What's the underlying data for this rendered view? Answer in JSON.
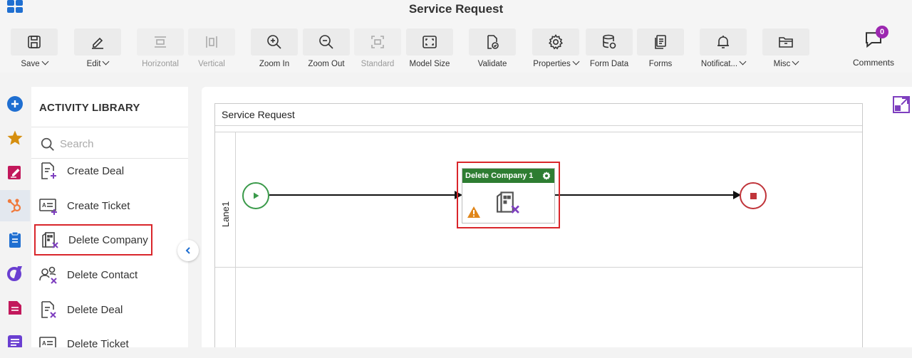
{
  "app": {
    "title": "Service Request"
  },
  "toolbar": {
    "items": [
      {
        "label": "Save",
        "dropdown": true,
        "icon": "save-icon"
      },
      {
        "label": "Edit",
        "dropdown": true,
        "icon": "pencil-icon"
      },
      {
        "label": "Horizontal",
        "disabled": true,
        "icon": "horizontal-icon"
      },
      {
        "label": "Vertical",
        "disabled": true,
        "icon": "vertical-icon"
      },
      {
        "label": "Zoom In",
        "icon": "zoom-in-icon"
      },
      {
        "label": "Zoom Out",
        "icon": "zoom-out-icon"
      },
      {
        "label": "Standard",
        "disabled": true,
        "icon": "standard-icon"
      },
      {
        "label": "Model Size",
        "icon": "model-size-icon"
      },
      {
        "label": "Validate",
        "icon": "validate-icon"
      },
      {
        "label": "Properties",
        "dropdown": true,
        "icon": "gear-icon"
      },
      {
        "label": "Form Data",
        "icon": "database-icon"
      },
      {
        "label": "Forms",
        "icon": "forms-icon"
      },
      {
        "label": "Notificat...",
        "dropdown": true,
        "icon": "bell-icon"
      },
      {
        "label": "Misc",
        "dropdown": true,
        "icon": "folder-icon"
      }
    ],
    "comments": {
      "label": "Comments",
      "count": "0"
    }
  },
  "library": {
    "title": "ACTIVITY LIBRARY",
    "search_placeholder": "Search",
    "items": [
      {
        "label": "Create Deal",
        "icon": "create-deal-icon"
      },
      {
        "label": "Create Ticket",
        "icon": "create-ticket-icon"
      },
      {
        "label": "Delete Company",
        "icon": "delete-company-icon",
        "highlighted": true
      },
      {
        "label": "Delete Contact",
        "icon": "delete-contact-icon"
      },
      {
        "label": "Delete Deal",
        "icon": "delete-deal-icon"
      },
      {
        "label": "Delete Ticket",
        "icon": "delete-ticket-icon"
      }
    ]
  },
  "canvas": {
    "pool_title": "Service Request",
    "lane_label": "Lane1",
    "task": {
      "title": "Delete Company 1"
    }
  },
  "colors": {
    "accent_blue": "#1f6fd1",
    "task_header": "#2e7d32",
    "start_event": "#3a9a4a",
    "end_event": "#c0343a",
    "highlight": "#d9262b",
    "icon_purple": "#7e3fbf"
  }
}
